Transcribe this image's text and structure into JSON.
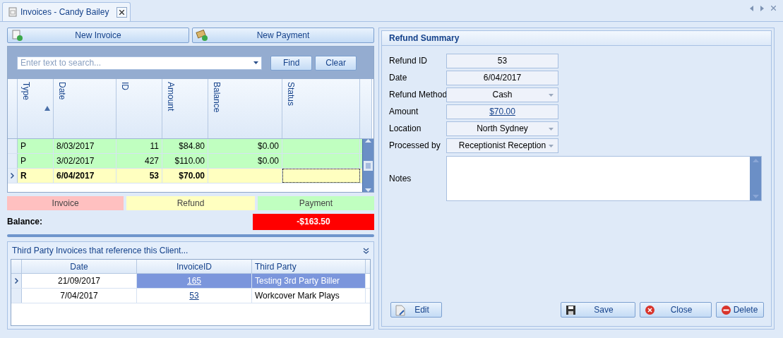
{
  "tab": {
    "title": "Invoices - Candy Bailey"
  },
  "toolbar": [
    {
      "label": "New Invoice",
      "kind": "invoice"
    },
    {
      "label": "New Payment",
      "kind": "payment"
    }
  ],
  "search": {
    "placeholder": "Enter text to search...",
    "buttons": [
      "Find",
      "Clear"
    ]
  },
  "grid": {
    "columns": [
      {
        "label": "Type",
        "sorted": true
      },
      {
        "label": "Date",
        "sorted": false
      },
      {
        "label": "ID",
        "sorted": false
      },
      {
        "label": "Amount",
        "sorted": false
      },
      {
        "label": "Balance",
        "sorted": false
      },
      {
        "label": "Status",
        "sorted": false
      }
    ],
    "rows": [
      {
        "color": "#c0ffc0",
        "selected": false,
        "cells": [
          "P",
          "8/03/2017",
          "11",
          "$84.80",
          "$0.00",
          ""
        ]
      },
      {
        "color": "#c0ffc0",
        "selected": false,
        "cells": [
          "P",
          "3/02/2017",
          "427",
          "$110.00",
          "$0.00",
          ""
        ]
      },
      {
        "color": "#ffffc0",
        "selected": true,
        "cells": [
          "R",
          "6/04/2017",
          "53",
          "$70.00",
          "",
          ""
        ]
      }
    ]
  },
  "legend": [
    {
      "label": "Invoice",
      "color": "#ffc0c0"
    },
    {
      "label": "Refund",
      "color": "#ffffc0"
    },
    {
      "label": "Payment",
      "color": "#c0ffc0"
    }
  ],
  "balance": {
    "label": "Balance:",
    "value": "-$163.50"
  },
  "third_party": {
    "title": "Third Party Invoices that reference this Client...",
    "columns": [
      "Date",
      "InvoiceID",
      "Third Party"
    ],
    "rows": [
      {
        "selected": true,
        "date": "21/09/2017",
        "invoice_id": "165",
        "third_party": "Testing 3rd Party Biller"
      },
      {
        "selected": false,
        "date": "7/04/2017",
        "invoice_id": "53",
        "third_party": "Workcover Mark Plays"
      }
    ]
  },
  "refund_summary": {
    "title": "Refund Summary",
    "fields": [
      {
        "label": "Refund ID",
        "value": "53",
        "kind": "text"
      },
      {
        "label": "Date",
        "value": "6/04/2017",
        "kind": "text"
      },
      {
        "label": "Refund Method",
        "value": "Cash",
        "kind": "dropdown"
      },
      {
        "label": "Amount",
        "value": "$70.00",
        "kind": "link"
      },
      {
        "label": "Location",
        "value": "North Sydney",
        "kind": "dropdown"
      },
      {
        "label": "Processed by",
        "value": "Receptionist Reception",
        "kind": "dropdown"
      }
    ],
    "notes": {
      "label": "Notes"
    },
    "buttons": [
      {
        "label": "Edit",
        "kind": "edit"
      },
      {
        "label": "Save",
        "kind": "save"
      },
      {
        "label": "Close",
        "kind": "close"
      },
      {
        "label": "Delete",
        "kind": "delete"
      }
    ]
  }
}
